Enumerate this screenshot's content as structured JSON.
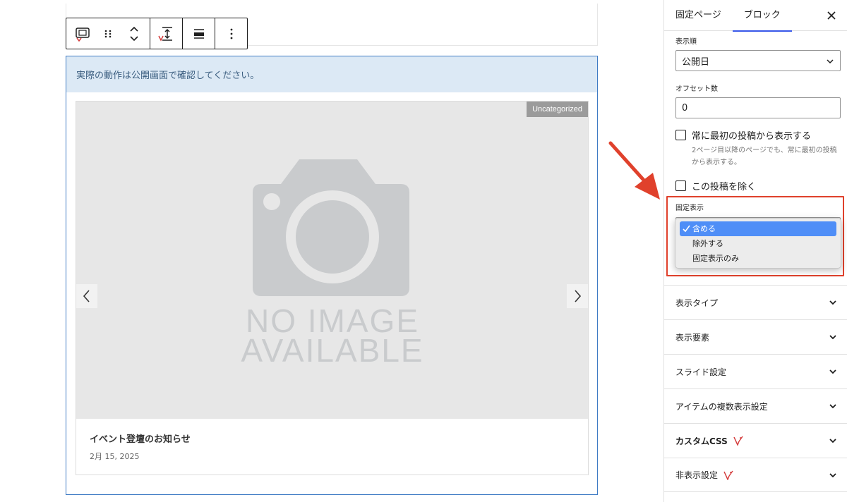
{
  "editor": {
    "notice_text": "実際の動作は公開画面で確認してください。",
    "card": {
      "category_badge": "Uncategorized",
      "image_placeholder_line1": "NO IMAGE",
      "image_placeholder_line2": "AVAILABLE",
      "title": "イベント登壇のお知らせ",
      "date": "2月 15, 2025"
    }
  },
  "sidebar": {
    "tabs": [
      {
        "label": "固定ページ",
        "active": false
      },
      {
        "label": "ブロック",
        "active": true
      }
    ],
    "order_label": "表示順",
    "order_value": "公開日",
    "offset_label": "オフセット数",
    "offset_value": "0",
    "always_first_label": "常に最初の投稿から表示する",
    "always_first_checked": false,
    "always_first_help": "2ページ目以降のページでも、常に最初の投稿から表示する。",
    "exclude_current_label": "この投稿を除く",
    "exclude_current_checked": false,
    "sticky_label": "固定表示",
    "sticky_options": [
      {
        "label": "含める",
        "selected": true
      },
      {
        "label": "除外する",
        "selected": false
      },
      {
        "label": "固定表示のみ",
        "selected": false
      }
    ],
    "panels": [
      {
        "label": "表示タイプ",
        "badge": false
      },
      {
        "label": "表示要素",
        "badge": false
      },
      {
        "label": "スライド設定",
        "badge": false
      },
      {
        "label": "アイテムの複数表示設定",
        "badge": false
      },
      {
        "label": "カスタムCSS",
        "badge": true
      },
      {
        "label": "非表示設定",
        "badge": true
      }
    ]
  },
  "colors": {
    "accent": "#3858e9",
    "block_border": "#3f7bc4",
    "notice_bg": "#dce9f5",
    "highlight_frame": "#e0412c",
    "selected_option": "#4f8ef7"
  }
}
